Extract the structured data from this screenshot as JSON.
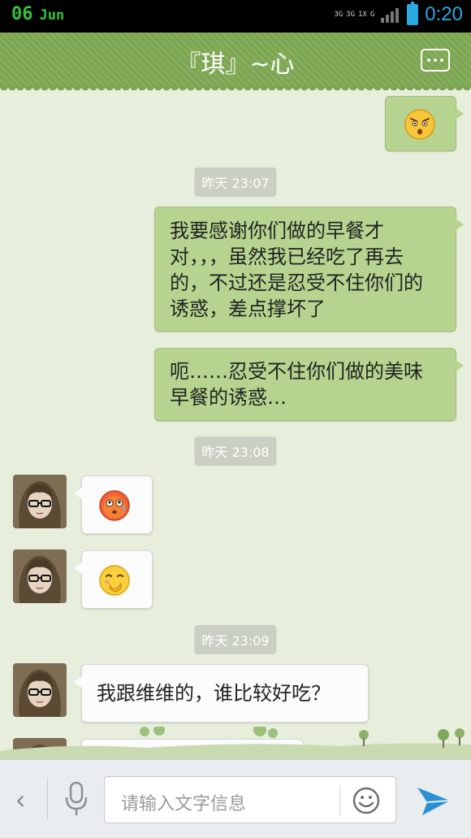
{
  "status_bar": {
    "day": "06",
    "month": "Jun",
    "network_labels": [
      "3G",
      "3G",
      "1X",
      "G"
    ],
    "time": "0:20"
  },
  "header": {
    "title": "『琪』~心"
  },
  "messages": {
    "emoji_out_1": "smile-squint-emoji",
    "ts1": "昨天 23:07",
    "out_text_1": "我要感谢你们做的早餐才对，，，虽然我已经吃了再去的，不过还是忍受不住你们的诱惑，差点撑坏了",
    "out_text_2": "呃……忍受不住你们做的美味早餐的诱惑…",
    "ts2": "昨天 23:08",
    "emoji_in_1": "embarrassed-sweat-emoji",
    "emoji_in_2": "shy-blush-emoji",
    "ts3": "昨天 23:09",
    "in_text_1": "我跟维维的，谁比较好吃？"
  },
  "input_bar": {
    "placeholder": "请输入文字信息"
  },
  "colors": {
    "header_green": "#7ba552",
    "outgoing_bubble": "#b6d48f",
    "incoming_bubble": "#fbfbfb",
    "chat_background": "#e7efdc",
    "status_time": "#2aa8e2",
    "send_icon": "#2a8fd4"
  }
}
